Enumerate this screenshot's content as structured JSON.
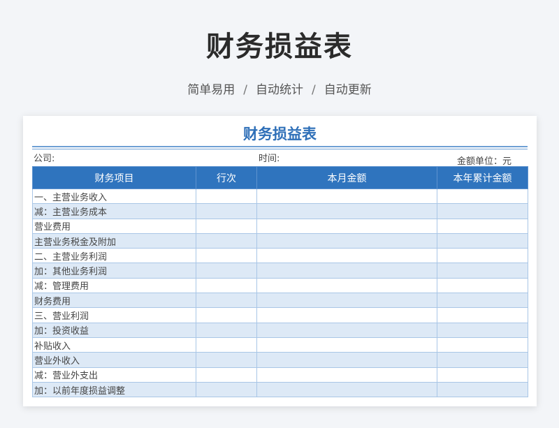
{
  "header": {
    "title": "财务损益表",
    "subtitle_items": [
      "简单易用",
      "自动统计",
      "自动更新"
    ],
    "separator": "/"
  },
  "sheet": {
    "title": "财务损益表",
    "company_label": "公司:",
    "time_label": "时间:",
    "unit_label": "金额单位：元",
    "columns": [
      "财务项目",
      "行次",
      "本月金额",
      "本年累计金额"
    ],
    "rows": [
      "一、主营业务收入",
      "减：主营业务成本",
      "营业费用",
      "主营业务税金及附加",
      "二、主营业务利润",
      "加：其他业务利润",
      "减：管理费用",
      "财务费用",
      "三、营业利润",
      "加：投资收益",
      "补贴收入",
      "营业外收入",
      "减：营业外支出",
      "加：以前年度损益调整"
    ]
  },
  "colors": {
    "accent": "#2f74be",
    "title_blue": "#2e6fb8",
    "row_alt": "#dde9f6"
  }
}
